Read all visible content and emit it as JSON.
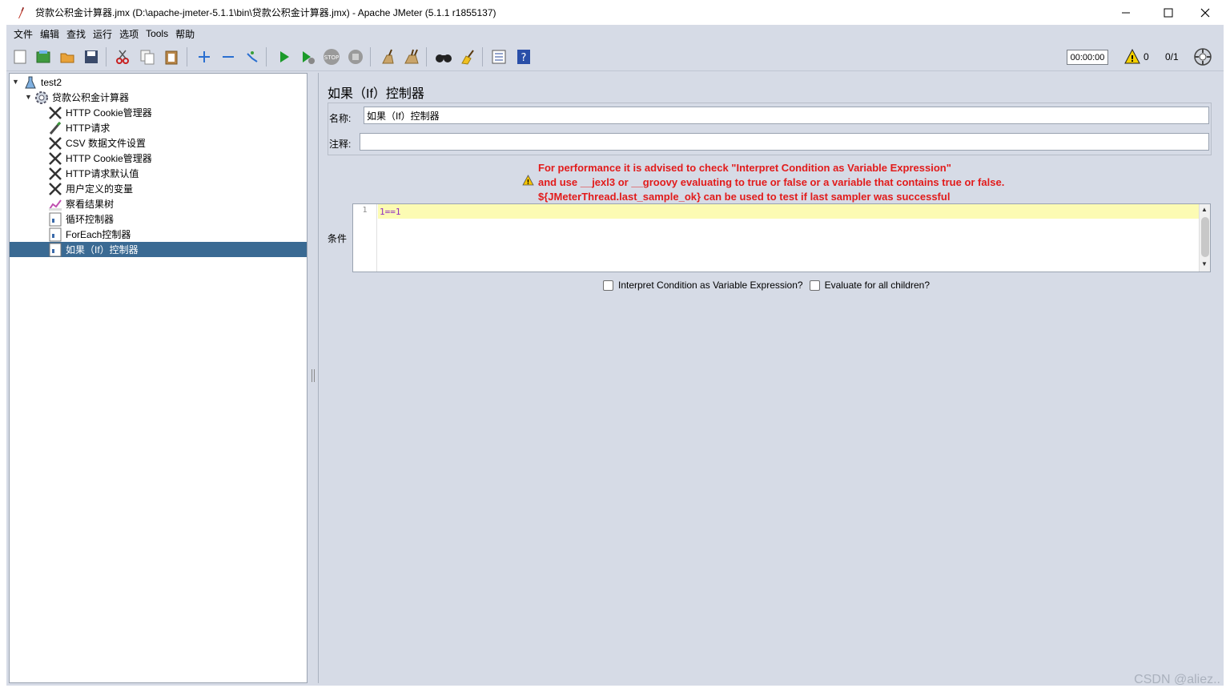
{
  "window": {
    "title": "贷款公积金计算器.jmx (D:\\apache-jmeter-5.1.1\\bin\\贷款公积金计算器.jmx) - Apache JMeter (5.1.1 r1855137)"
  },
  "menu": [
    "文件",
    "编辑",
    "查找",
    "运行",
    "选项",
    "Tools",
    "帮助"
  ],
  "toolbar": {
    "timer": "00:00:00",
    "warning_count": "0",
    "threads": "0/1"
  },
  "tree": {
    "items": [
      {
        "label": "test2",
        "icon": "test-plan-icon"
      },
      {
        "label": "贷款公积金计算器",
        "icon": "thread-group-gear-icon"
      },
      {
        "label": "HTTP Cookie管理器",
        "icon": "config-tools-icon"
      },
      {
        "label": "HTTP请求",
        "icon": "sampler-pen-icon"
      },
      {
        "label": "CSV 数据文件设置",
        "icon": "config-tools-icon"
      },
      {
        "label": "HTTP Cookie管理器",
        "icon": "config-tools-icon"
      },
      {
        "label": "HTTP请求默认值",
        "icon": "config-tools-icon"
      },
      {
        "label": "用户定义的变量",
        "icon": "config-tools-icon"
      },
      {
        "label": "察看结果树",
        "icon": "listener-chart-icon"
      },
      {
        "label": "循环控制器",
        "icon": "controller-icon"
      },
      {
        "label": "ForEach控制器",
        "icon": "controller-icon"
      },
      {
        "label": "如果（If）控制器",
        "icon": "controller-icon"
      }
    ]
  },
  "panel": {
    "title": "如果（If）控制器",
    "name_label": "名称:",
    "name_value": "如果（If）控制器",
    "comment_label": "注释:",
    "comment_value": "",
    "warning_lines": [
      "For performance it is advised to check \"Interpret Condition as Variable Expression\"",
      "and use __jexl3 or __groovy evaluating to true or false or a variable that contains true or false.",
      "${JMeterThread.last_sample_ok} can be used to test if last sampler was successful"
    ],
    "condition_label": "条件",
    "editor_line_number": "1",
    "condition_value": "1==1",
    "checkbox_interpret": "Interpret Condition as Variable Expression?",
    "checkbox_evaluate": "Evaluate for all children?"
  },
  "watermark": "CSDN @aliez..",
  "colors": {
    "panel_bg": "#d6dbe6",
    "selection": "#3a6a93",
    "warning_text": "#e21b1b",
    "editor_line": "#fcfbb3"
  }
}
